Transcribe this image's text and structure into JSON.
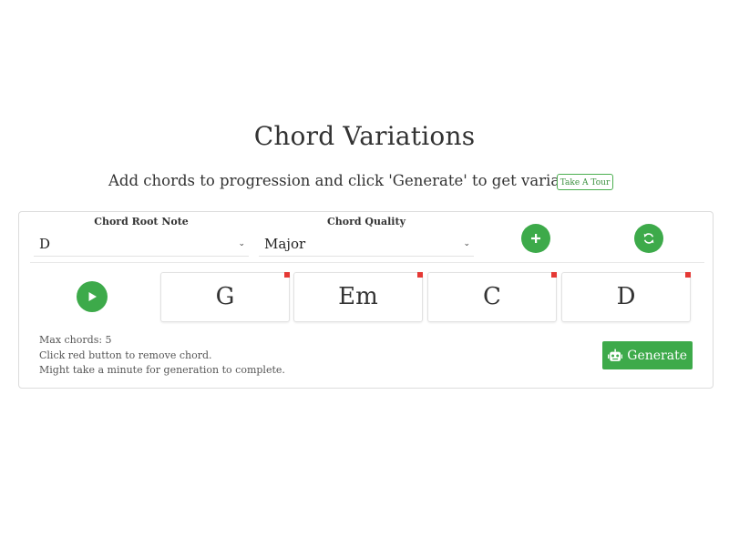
{
  "page": {
    "title": "Chord Variations",
    "subtitle": "Add chords to progression and click 'Generate' to get variations",
    "tour_button": "Take A Tour"
  },
  "controls": {
    "root_label": "Chord Root Note",
    "root_value": "D",
    "quality_label": "Chord Quality",
    "quality_value": "Major",
    "add_icon": "plus-icon",
    "refresh_icon": "refresh-icon"
  },
  "progression": {
    "play_icon": "play-icon",
    "chords": [
      "G",
      "Em",
      "C",
      "D"
    ]
  },
  "notes": [
    "Max chords: 5",
    "Click red button to remove chord.",
    "Might take a minute for generation to complete."
  ],
  "generate": {
    "label": "Generate",
    "icon": "robot-icon"
  },
  "colors": {
    "accent": "#3daa4a",
    "remove": "#e53935"
  }
}
